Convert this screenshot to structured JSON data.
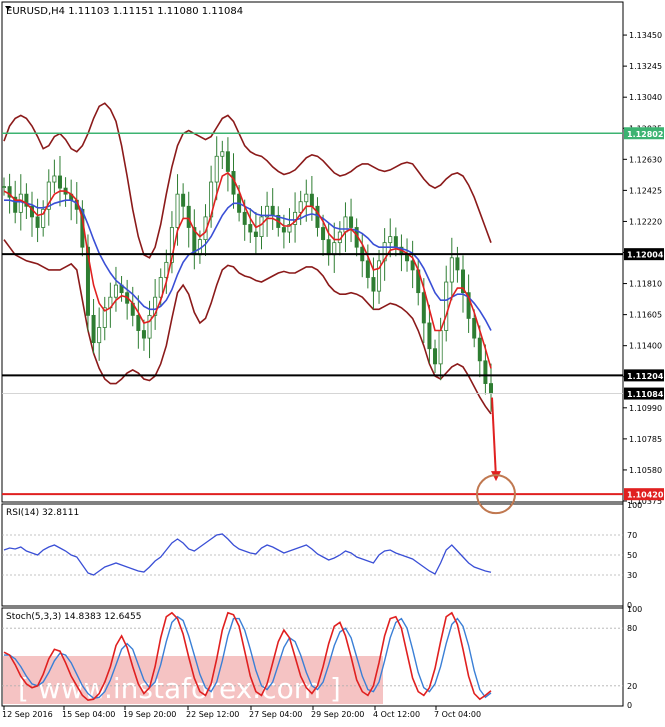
{
  "header": {
    "symbol_line": "EURUSD,H4  1.11103 1.11151 1.11080 1.11084"
  },
  "colors": {
    "candle": "#2e7d32",
    "bollinger": "#8b1a1a",
    "fast_ma": "#e02020",
    "slow_ma": "#3a4fd6",
    "support_resistance": "#000000",
    "target_line": "#e02020",
    "top_line": "#3cb371",
    "target_circle": "#c07850",
    "rsi_line": "#3a4fd6",
    "stoch_main": "#e02020",
    "stoch_signal": "#3a7fd6",
    "watermark_bg": "#f3b8b8"
  },
  "chart_data": [
    {
      "type": "line",
      "name": "price",
      "title": "EURUSD,H4  1.11103 1.11151 1.11080 1.11084",
      "instrument": "EURUSD",
      "timeframe": "H4",
      "ohlc_last": {
        "open": 1.11103,
        "high": 1.11151,
        "low": 1.1108,
        "close": 1.11084
      },
      "ylim": [
        1.10375,
        1.13655
      ],
      "y_ticks": [
        "1.13450",
        "1.13245",
        "1.13040",
        "1.12835",
        "1.12630",
        "1.12425",
        "1.12220",
        "1.12015",
        "1.11810",
        "1.11605",
        "1.11400",
        "1.11195",
        "1.10990",
        "1.10785",
        "1.10580",
        "1.10375"
      ],
      "x_ticks": [
        "12 Sep 2016",
        "15 Sep 04:00",
        "19 Sep 20:00",
        "22 Sep 12:00",
        "27 Sep 04:00",
        "29 Sep 20:00",
        "4 Oct 12:00",
        "7 Oct 04:00"
      ],
      "levels": [
        {
          "value": 1.12802,
          "label": "1.12802",
          "kind": "top"
        },
        {
          "value": 1.12004,
          "label": "1.12004",
          "kind": "sr"
        },
        {
          "value": 1.11204,
          "label": "1.11204",
          "kind": "sr"
        },
        {
          "value": 1.11084,
          "label": "1.11084",
          "kind": "current"
        },
        {
          "value": 1.1042,
          "label": "1.10420",
          "kind": "target"
        }
      ],
      "close_series": [
        1.1245,
        1.1238,
        1.1228,
        1.124,
        1.1232,
        1.1225,
        1.1218,
        1.123,
        1.1248,
        1.1252,
        1.1244,
        1.124,
        1.1236,
        1.123,
        1.1205,
        1.116,
        1.1142,
        1.1152,
        1.1165,
        1.1172,
        1.118,
        1.1175,
        1.1168,
        1.116,
        1.115,
        1.1145,
        1.116,
        1.1172,
        1.1185,
        1.1195,
        1.1218,
        1.124,
        1.1232,
        1.1218,
        1.12,
        1.121,
        1.1225,
        1.1248,
        1.1265,
        1.1268,
        1.1255,
        1.124,
        1.1228,
        1.122,
        1.1215,
        1.1212,
        1.1225,
        1.1232,
        1.1226,
        1.1218,
        1.1215,
        1.122,
        1.1228,
        1.1235,
        1.124,
        1.1232,
        1.1218,
        1.121,
        1.12,
        1.1208,
        1.1215,
        1.1225,
        1.1218,
        1.1205,
        1.1196,
        1.1185,
        1.1176,
        1.1196,
        1.1208,
        1.1212,
        1.1205,
        1.12,
        1.1196,
        1.119,
        1.1175,
        1.1155,
        1.1138,
        1.1128,
        1.115,
        1.1182,
        1.1198,
        1.119,
        1.1175,
        1.1158,
        1.1145,
        1.113,
        1.1115,
        1.11084
      ],
      "fast_ma": [
        1.1242,
        1.124,
        1.1236,
        1.1236,
        1.1234,
        1.123,
        1.1226,
        1.1227,
        1.1234,
        1.124,
        1.1242,
        1.1242,
        1.124,
        1.1236,
        1.1224,
        1.12,
        1.118,
        1.1168,
        1.1163,
        1.1165,
        1.117,
        1.1173,
        1.1172,
        1.1168,
        1.1162,
        1.1155,
        1.1156,
        1.1161,
        1.117,
        1.1182,
        1.1198,
        1.1216,
        1.1224,
        1.1224,
        1.1216,
        1.1212,
        1.1215,
        1.1226,
        1.124,
        1.1252,
        1.1254,
        1.125,
        1.1242,
        1.1232,
        1.1224,
        1.1218,
        1.122,
        1.1224,
        1.1224,
        1.1222,
        1.1219,
        1.1219,
        1.1222,
        1.1227,
        1.1232,
        1.1232,
        1.1228,
        1.1222,
        1.1214,
        1.121,
        1.121,
        1.1215,
        1.1217,
        1.1213,
        1.1207,
        1.1199,
        1.119,
        1.1191,
        1.1197,
        1.1203,
        1.1204,
        1.1203,
        1.1201,
        1.1198,
        1.119,
        1.1178,
        1.1164,
        1.115,
        1.115,
        1.116,
        1.1172,
        1.1178,
        1.1178,
        1.1172,
        1.1162,
        1.115,
        1.1138,
        1.1125
      ],
      "slow_ma": [
        1.1236,
        1.1236,
        1.1235,
        1.1235,
        1.1234,
        1.1233,
        1.1231,
        1.1231,
        1.1232,
        1.1234,
        1.1235,
        1.1236,
        1.1236,
        1.1234,
        1.1229,
        1.122,
        1.121,
        1.1201,
        1.1194,
        1.1188,
        1.1183,
        1.118,
        1.1177,
        1.1174,
        1.117,
        1.1166,
        1.1164,
        1.1164,
        1.1166,
        1.117,
        1.1177,
        1.1187,
        1.1195,
        1.12,
        1.1202,
        1.1204,
        1.1207,
        1.1212,
        1.1219,
        1.1226,
        1.1231,
        1.1234,
        1.1234,
        1.1232,
        1.123,
        1.1227,
        1.1226,
        1.1226,
        1.1226,
        1.1225,
        1.1224,
        1.1223,
        1.1223,
        1.1224,
        1.1226,
        1.1227,
        1.1226,
        1.1224,
        1.1221,
        1.1218,
        1.1217,
        1.1217,
        1.1217,
        1.1216,
        1.1214,
        1.1211,
        1.1207,
        1.1205,
        1.1205,
        1.1205,
        1.1205,
        1.1204,
        1.1203,
        1.1201,
        1.1197,
        1.1191,
        1.1183,
        1.1175,
        1.117,
        1.117,
        1.1172,
        1.1174,
        1.1174,
        1.1172,
        1.1168,
        1.1163,
        1.1157,
        1.115
      ],
      "bb_upper": [
        1.1275,
        1.1285,
        1.129,
        1.1292,
        1.129,
        1.1285,
        1.1278,
        1.127,
        1.1272,
        1.1278,
        1.128,
        1.1276,
        1.127,
        1.1268,
        1.1272,
        1.128,
        1.129,
        1.1298,
        1.13,
        1.1296,
        1.1288,
        1.1272,
        1.1252,
        1.123,
        1.1212,
        1.12,
        1.1198,
        1.1205,
        1.122,
        1.124,
        1.1258,
        1.1272,
        1.128,
        1.1282,
        1.128,
        1.1278,
        1.1276,
        1.1278,
        1.1284,
        1.129,
        1.1292,
        1.1288,
        1.128,
        1.1272,
        1.1268,
        1.1266,
        1.1265,
        1.1262,
        1.1258,
        1.1255,
        1.1253,
        1.1254,
        1.1256,
        1.126,
        1.1264,
        1.1266,
        1.1265,
        1.1262,
        1.1258,
        1.1254,
        1.1252,
        1.1253,
        1.1255,
        1.1258,
        1.126,
        1.126,
        1.1258,
        1.1256,
        1.1255,
        1.1256,
        1.1258,
        1.126,
        1.1261,
        1.126,
        1.1255,
        1.125,
        1.1246,
        1.1244,
        1.1246,
        1.125,
        1.1253,
        1.1254,
        1.1252,
        1.1246,
        1.1238,
        1.1228,
        1.1218,
        1.1208
      ],
      "bb_lower": [
        1.121,
        1.1205,
        1.12,
        1.1198,
        1.1196,
        1.1195,
        1.1194,
        1.1192,
        1.119,
        1.119,
        1.119,
        1.1192,
        1.1194,
        1.119,
        1.117,
        1.115,
        1.1135,
        1.1125,
        1.1118,
        1.1115,
        1.1115,
        1.1118,
        1.1122,
        1.1124,
        1.1122,
        1.1118,
        1.1117,
        1.112,
        1.1128,
        1.114,
        1.1158,
        1.1175,
        1.118,
        1.1174,
        1.1162,
        1.1155,
        1.1158,
        1.1168,
        1.118,
        1.119,
        1.1193,
        1.1192,
        1.1188,
        1.1186,
        1.1185,
        1.1183,
        1.1182,
        1.1184,
        1.1186,
        1.1188,
        1.1189,
        1.1188,
        1.1188,
        1.119,
        1.1192,
        1.1192,
        1.119,
        1.1186,
        1.118,
        1.1176,
        1.1174,
        1.1174,
        1.1175,
        1.1174,
        1.1172,
        1.1168,
        1.1164,
        1.1164,
        1.1166,
        1.1168,
        1.1167,
        1.1165,
        1.1162,
        1.1158,
        1.115,
        1.114,
        1.1128,
        1.112,
        1.1118,
        1.1122,
        1.1126,
        1.1128,
        1.1126,
        1.112,
        1.1113,
        1.1106,
        1.11,
        1.1095
      ]
    },
    {
      "type": "line",
      "name": "rsi",
      "label": "RSI(14) 32.8111",
      "ylim": [
        0,
        100
      ],
      "y_ticks": [
        "100",
        "70",
        "50",
        "30",
        "0"
      ],
      "values": [
        55,
        57,
        56,
        58,
        54,
        52,
        50,
        55,
        58,
        60,
        57,
        54,
        50,
        48,
        40,
        32,
        30,
        34,
        38,
        40,
        42,
        40,
        38,
        36,
        34,
        33,
        38,
        44,
        48,
        55,
        62,
        66,
        62,
        56,
        54,
        58,
        62,
        66,
        70,
        71,
        66,
        60,
        56,
        54,
        52,
        51,
        57,
        60,
        58,
        55,
        52,
        54,
        56,
        58,
        60,
        56,
        51,
        48,
        45,
        47,
        50,
        54,
        52,
        48,
        46,
        44,
        42,
        50,
        54,
        55,
        52,
        50,
        48,
        46,
        42,
        38,
        34,
        31,
        42,
        55,
        60,
        54,
        48,
        42,
        38,
        36,
        34,
        32.8111
      ]
    },
    {
      "type": "line",
      "name": "stochastic",
      "label": "Stoch(5,3,3) 14.8383 12.6455",
      "ylim": [
        0,
        100
      ],
      "y_ticks": [
        "100",
        "80",
        "20",
        "0"
      ],
      "main": [
        55,
        52,
        42,
        30,
        22,
        18,
        20,
        32,
        48,
        58,
        56,
        44,
        30,
        20,
        10,
        5,
        6,
        12,
        24,
        40,
        62,
        72,
        60,
        40,
        22,
        12,
        18,
        40,
        70,
        92,
        96,
        90,
        74,
        50,
        28,
        14,
        10,
        22,
        48,
        78,
        96,
        94,
        82,
        56,
        30,
        14,
        10,
        22,
        44,
        66,
        78,
        70,
        50,
        30,
        18,
        12,
        20,
        40,
        64,
        82,
        86,
        72,
        50,
        26,
        14,
        10,
        20,
        44,
        72,
        90,
        92,
        80,
        54,
        28,
        14,
        10,
        18,
        38,
        66,
        92,
        96,
        84,
        58,
        30,
        12,
        6,
        10,
        14.8383
      ],
      "signal": [
        52,
        52,
        48,
        40,
        30,
        22,
        20,
        24,
        34,
        46,
        54,
        52,
        44,
        32,
        20,
        12,
        7,
        8,
        14,
        26,
        42,
        58,
        64,
        58,
        42,
        26,
        18,
        24,
        42,
        66,
        86,
        92,
        88,
        72,
        52,
        32,
        18,
        14,
        24,
        46,
        72,
        90,
        90,
        78,
        58,
        36,
        20,
        16,
        24,
        42,
        60,
        70,
        66,
        52,
        34,
        20,
        16,
        24,
        42,
        62,
        76,
        80,
        70,
        50,
        30,
        16,
        14,
        24,
        46,
        70,
        86,
        90,
        80,
        58,
        34,
        18,
        14,
        22,
        40,
        64,
        84,
        90,
        82,
        62,
        36,
        16,
        8,
        12.6455
      ]
    }
  ],
  "watermark": {
    "text": "[ www.instaforex.com ]"
  },
  "icons": {
    "dropdown_marker": "triangle-down-icon"
  }
}
